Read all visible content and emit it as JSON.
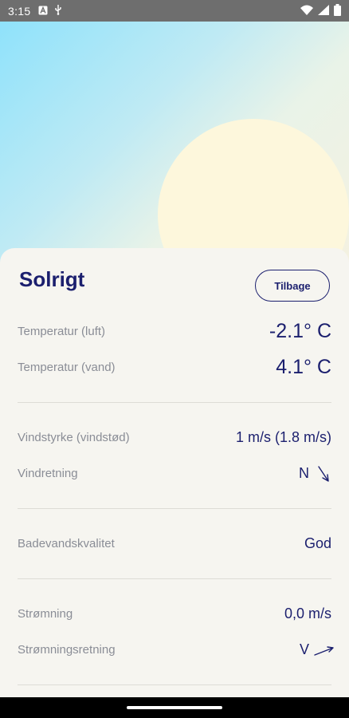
{
  "status_bar": {
    "time": "3:15",
    "icons": [
      "notification-a-icon",
      "usb-icon",
      "wifi-icon",
      "signal-icon",
      "battery-icon"
    ]
  },
  "colors": {
    "accent": "#1b1f6e",
    "label": "#8a8d96",
    "card_bg": "#f6f5f0",
    "sun": "#fdf7dc"
  },
  "card": {
    "title": "Solrigt",
    "back_label": "Tilbage"
  },
  "groups": [
    {
      "rows": [
        {
          "label": "Temperatur (luft)",
          "value": "-2.1° C"
        },
        {
          "label": "Temperatur (vand)",
          "value": "4.1° C"
        }
      ]
    },
    {
      "rows": [
        {
          "label": "Vindstyrke (vindstød)",
          "value": "1 m/s (1.8 m/s)"
        },
        {
          "label": "Vindretning",
          "value": "N",
          "icon": "arrow-south-east-icon"
        }
      ]
    },
    {
      "rows": [
        {
          "label": "Badevandskvalitet",
          "value": "God"
        }
      ]
    },
    {
      "rows": [
        {
          "label": "Strømning",
          "value": "0,0 m/s"
        },
        {
          "label": "Strømningsretning",
          "value": "V",
          "icon": "arrow-east-icon"
        }
      ]
    }
  ]
}
